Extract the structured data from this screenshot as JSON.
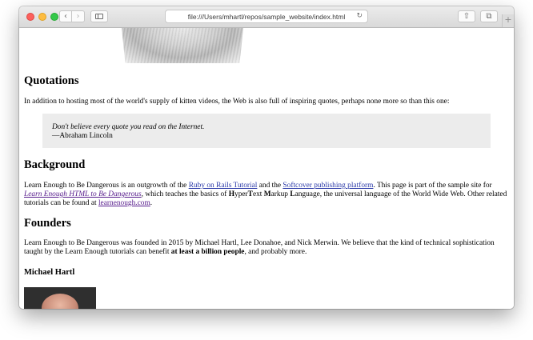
{
  "browser": {
    "address_url": "file:///Users/mhartl/repos/sample_website/index.html",
    "icons": [
      "back-icon",
      "forward-icon",
      "sidebar-icon",
      "reload-icon",
      "share-icon",
      "tabs-icon",
      "new-tab-icon"
    ],
    "back_glyph": "‹",
    "forward_glyph": "›",
    "reload_glyph": "↻",
    "share_glyph": "⇧",
    "tabs_glyph": "⧉",
    "plus_glyph": "+"
  },
  "page": {
    "quotations": {
      "heading": "Quotations",
      "intro": "In addition to hosting most of the world's supply of kitten videos, the Web is also full of inspiring quotes, perhaps none more so than this one:",
      "quote": "Don't believe every quote you read on the Internet.",
      "attribution": "—Abraham Lincoln"
    },
    "background": {
      "heading": "Background",
      "t1": "Learn Enough to Be Dangerous is an outgrowth of the ",
      "link1": "Ruby on Rails Tutorial",
      "t2": " and the ",
      "link2": "Softcover publishing platform",
      "t3": ". This page is part of the sample site for ",
      "link3": "Learn Enough HTML to Be Dangerous",
      "t4": ", which teaches the basics of ",
      "b1": "H",
      "t5": "yper",
      "b2": "T",
      "t6": "ext ",
      "b3": "M",
      "t7": "arkup ",
      "b4": "L",
      "t8": "anguage, the universal language of the World Wide Web. Other related tutorials can be found at ",
      "link4": "learnenough.com",
      "t9": "."
    },
    "founders": {
      "heading": "Founders",
      "t1": "Learn Enough to Be Dangerous was founded in 2015 by Michael Hartl, Lee Donahoe, and Nick Merwin. We believe that the kind of technical sophistication taught by the Learn Enough tutorials can benefit ",
      "bold": "at least a billion people",
      "t2": ", and probably more."
    },
    "michael": {
      "heading": "Michael Hartl"
    }
  },
  "colors": {
    "link": "#2a39a8",
    "visited_link": "#551a8b",
    "quote_background": "#ececec"
  }
}
